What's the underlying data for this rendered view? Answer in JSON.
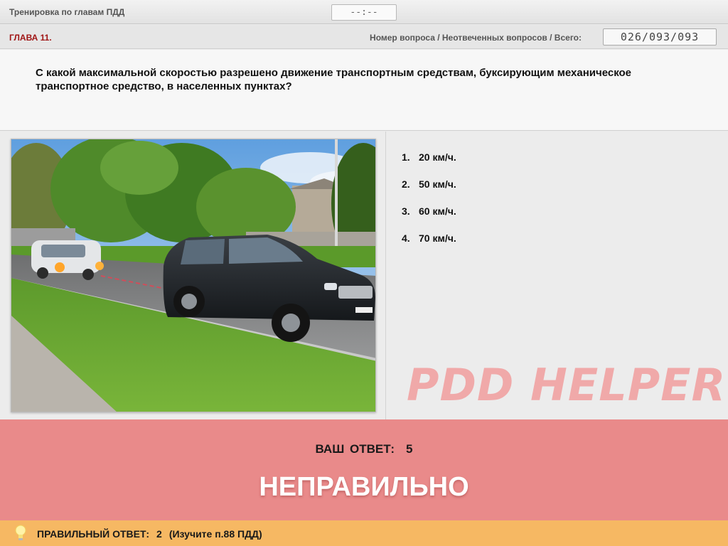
{
  "header": {
    "title": "Тренировка по главам ПДД",
    "timer": "--:--"
  },
  "info": {
    "chapter": "ГЛАВА 11.",
    "counter_label": "Номер вопроса / Неотвеченных вопросов / Всего:",
    "counter_value": "026/093/093"
  },
  "question": {
    "text": "С какой максимальной скоростью разрешено движение транспортным средствам, буксирующим механическое транспортное средство, в населенных пунктах?"
  },
  "answers": [
    {
      "num": "1.",
      "label": "20 км/ч."
    },
    {
      "num": "2.",
      "label": "50 км/ч."
    },
    {
      "num": "3.",
      "label": "60 км/ч."
    },
    {
      "num": "4.",
      "label": "70 км/ч."
    }
  ],
  "watermark": "PDD HELPER",
  "result": {
    "your_answer_label": "ВАШ ОТВЕТ:",
    "your_answer_value": "5",
    "verdict": "НЕПРАВИЛЬНО"
  },
  "correct": {
    "label": "ПРАВИЛЬНЫЙ ОТВЕТ:",
    "value": "2",
    "hint": "(Изучите п.88 ПДД)",
    "icon": "lightbulb-icon"
  },
  "colors": {
    "chapter": "#a01616",
    "result_bg": "#e98a8a",
    "correct_bg": "#f6b863",
    "watermark": "#f0a9a9"
  }
}
